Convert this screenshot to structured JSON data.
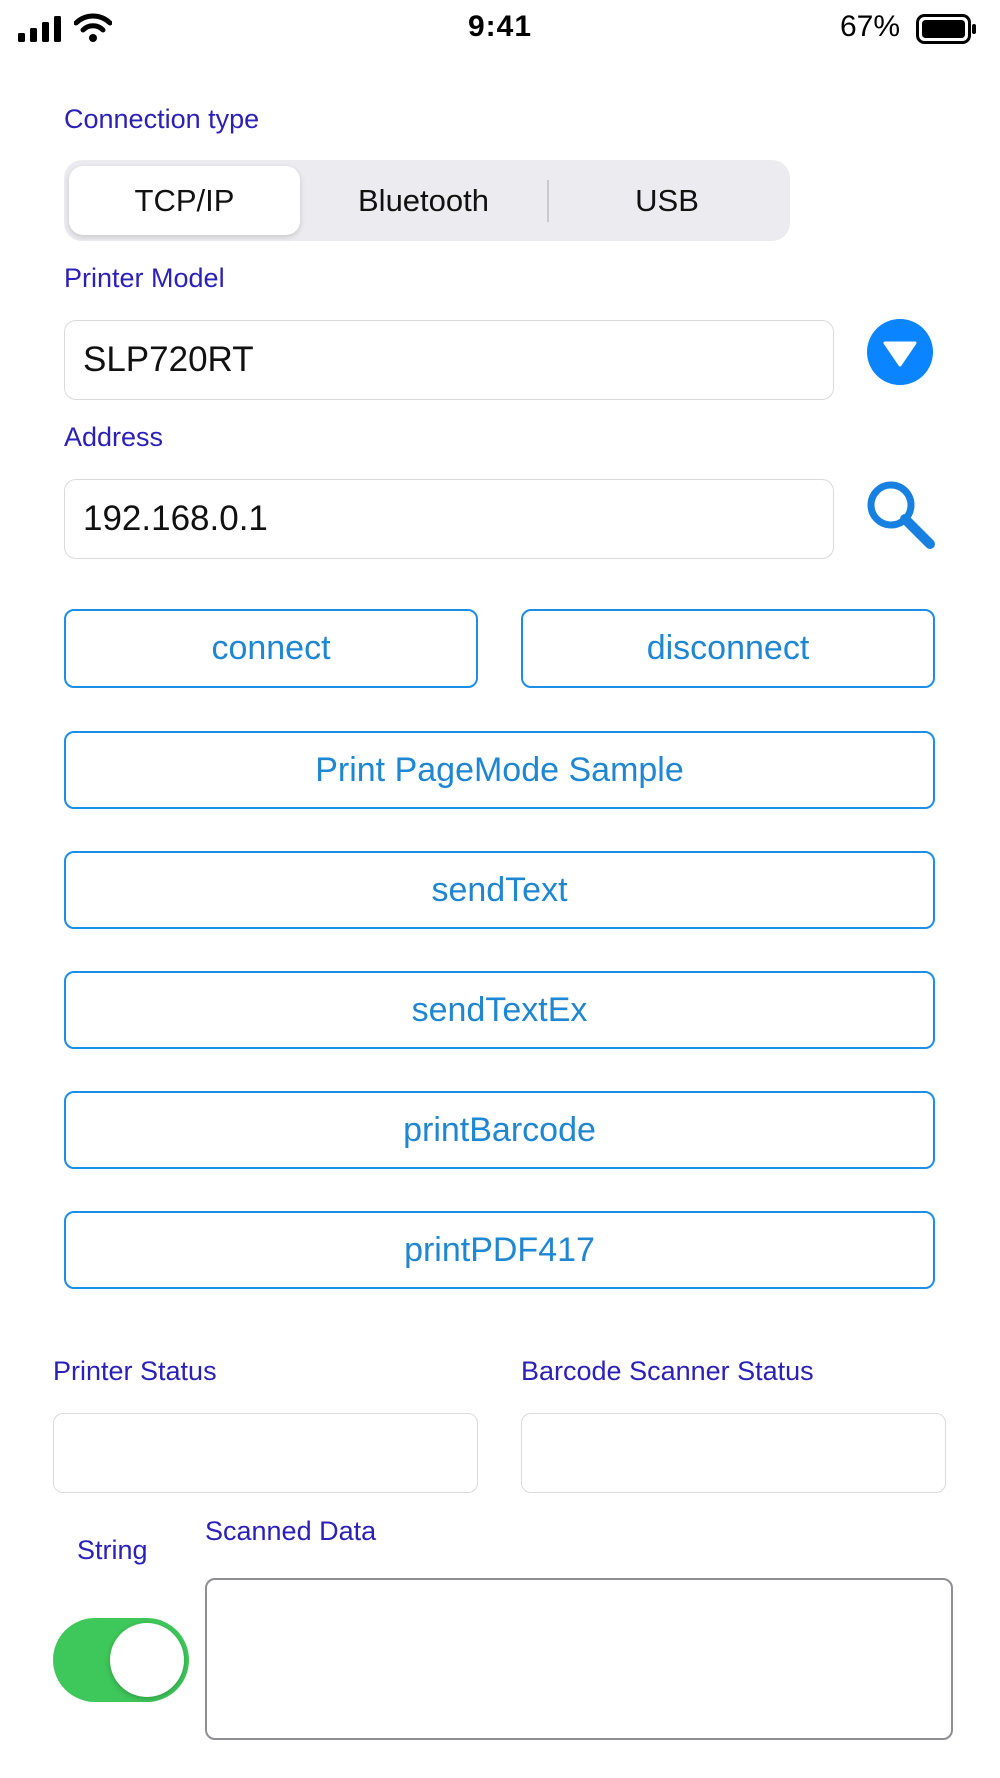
{
  "status_bar": {
    "time": "9:41",
    "battery_percent": "67%",
    "icons": [
      "signal-icon",
      "wifi-icon",
      "battery-icon"
    ]
  },
  "connection": {
    "label": "Connection type",
    "options": [
      "TCP/IP",
      "Bluetooth",
      "USB"
    ],
    "selected": "TCP/IP"
  },
  "printer_model": {
    "label": "Printer Model",
    "value": "SLP720RT",
    "dropdown_icon": "chevron-down-circle-icon"
  },
  "address": {
    "label": "Address",
    "value": "192.168.0.1",
    "search_icon": "search-icon"
  },
  "buttons": {
    "connect": "connect",
    "disconnect": "disconnect",
    "print_pagemode_sample": "Print PageMode Sample",
    "send_text": "sendText",
    "send_text_ex": "sendTextEx",
    "print_barcode": "printBarcode",
    "print_pdf417": "printPDF417"
  },
  "status": {
    "printer_label": "Printer Status",
    "printer_value": "",
    "scanner_label": "Barcode Scanner Status",
    "scanner_value": ""
  },
  "scan": {
    "toggle_label": "String",
    "toggle_on": true,
    "data_label": "Scanned Data",
    "data_value": ""
  },
  "colors": {
    "label_text": "#2b20b8",
    "button_text": "#1f86d2",
    "button_border": "#1c8ee8",
    "accent_blue": "#0a84ff",
    "toggle_on": "#3ec75a"
  }
}
